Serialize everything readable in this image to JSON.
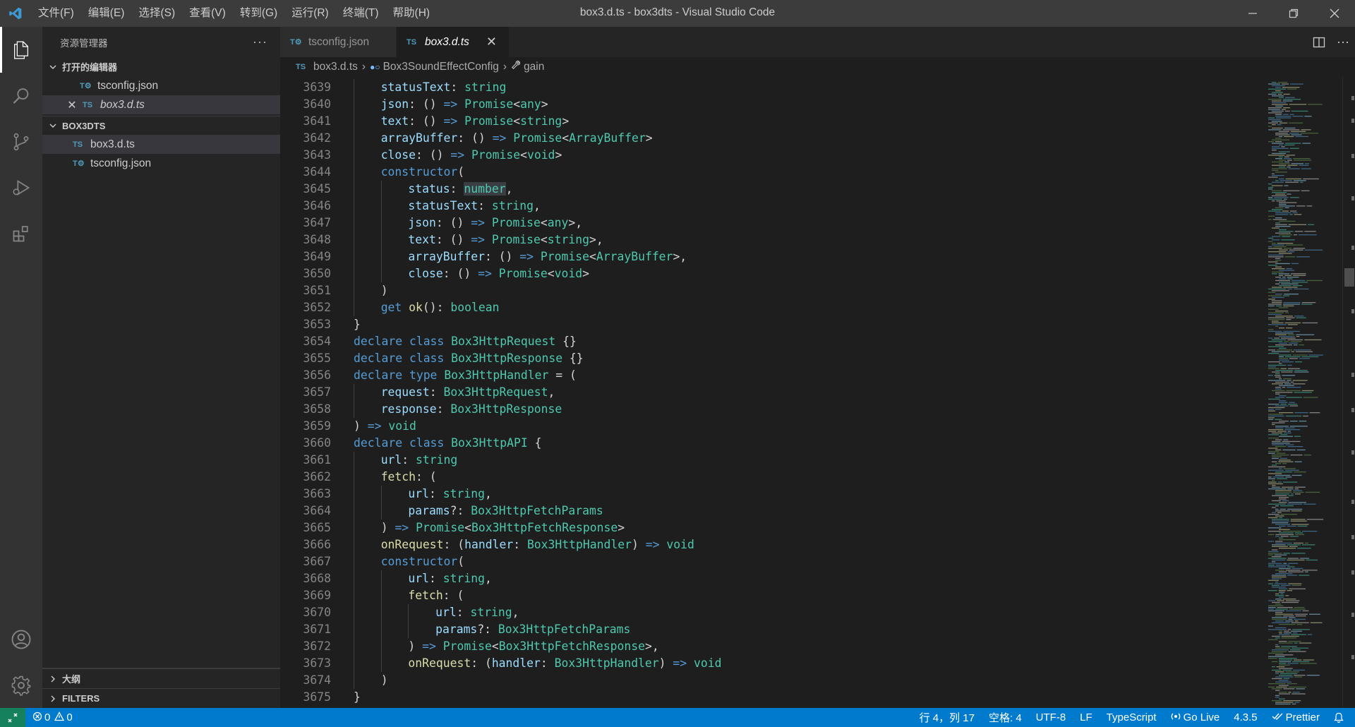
{
  "window": {
    "title": "box3.d.ts - box3dts - Visual Studio Code",
    "menu": [
      "文件(F)",
      "编辑(E)",
      "选择(S)",
      "查看(V)",
      "转到(G)",
      "运行(R)",
      "终端(T)",
      "帮助(H)"
    ]
  },
  "sidebar": {
    "title": "资源管理器",
    "open_editors": {
      "title": "打开的编辑器",
      "items": [
        {
          "icon": "tsconfig-file-icon",
          "label": "tsconfig.json"
        },
        {
          "icon": "typescript-file-icon",
          "label": "box3.d.ts"
        }
      ]
    },
    "folder": {
      "title": "BOX3DTS",
      "items": [
        {
          "icon": "typescript-file-icon",
          "label": "box3.d.ts"
        },
        {
          "icon": "tsconfig-file-icon",
          "label": "tsconfig.json"
        }
      ]
    },
    "outline": "大纲",
    "filters": "FILTERS"
  },
  "tabs": [
    {
      "label": "tsconfig.json",
      "active": false
    },
    {
      "label": "box3.d.ts",
      "active": true
    }
  ],
  "breadcrumb": [
    "box3.d.ts",
    "Box3SoundEffectConfig",
    "gain"
  ],
  "code_lines": [
    {
      "n": "3639",
      "indent": 1
    },
    {
      "n": "3640",
      "indent": 1
    },
    {
      "n": "3641",
      "indent": 1
    },
    {
      "n": "3642",
      "indent": 1
    },
    {
      "n": "3643",
      "indent": 1
    },
    {
      "n": "3644",
      "indent": 1
    },
    {
      "n": "3645",
      "indent": 2
    },
    {
      "n": "3646",
      "indent": 2
    },
    {
      "n": "3647",
      "indent": 2
    },
    {
      "n": "3648",
      "indent": 2
    },
    {
      "n": "3649",
      "indent": 2
    },
    {
      "n": "3650",
      "indent": 2
    },
    {
      "n": "3651",
      "indent": 1
    },
    {
      "n": "3652",
      "indent": 1
    },
    {
      "n": "3653",
      "indent": 0
    },
    {
      "n": "3654",
      "indent": 0
    },
    {
      "n": "3655",
      "indent": 0
    },
    {
      "n": "3656",
      "indent": 0
    },
    {
      "n": "3657",
      "indent": 1
    },
    {
      "n": "3658",
      "indent": 1
    },
    {
      "n": "3659",
      "indent": 0
    },
    {
      "n": "3660",
      "indent": 0
    },
    {
      "n": "3661",
      "indent": 1
    },
    {
      "n": "3662",
      "indent": 1
    },
    {
      "n": "3663",
      "indent": 2
    },
    {
      "n": "3664",
      "indent": 2
    },
    {
      "n": "3665",
      "indent": 1
    },
    {
      "n": "3666",
      "indent": 1
    },
    {
      "n": "3667",
      "indent": 1
    },
    {
      "n": "3668",
      "indent": 2
    },
    {
      "n": "3669",
      "indent": 2
    },
    {
      "n": "3670",
      "indent": 3
    },
    {
      "n": "3671",
      "indent": 3
    },
    {
      "n": "3672",
      "indent": 2
    },
    {
      "n": "3673",
      "indent": 2
    },
    {
      "n": "3674",
      "indent": 1
    },
    {
      "n": "3675",
      "indent": 0
    }
  ],
  "code_tokens": [
    [
      [
        "v",
        "statusText"
      ],
      [
        "p",
        ": "
      ],
      [
        "t",
        "string"
      ]
    ],
    [
      [
        "v",
        "json"
      ],
      [
        "p",
        ": () "
      ],
      [
        "k",
        "=>"
      ],
      [
        "p",
        " "
      ],
      [
        "t",
        "Promise"
      ],
      [
        "p",
        "<"
      ],
      [
        "t",
        "any"
      ],
      [
        "p",
        ">"
      ]
    ],
    [
      [
        "v",
        "text"
      ],
      [
        "p",
        ": () "
      ],
      [
        "k",
        "=>"
      ],
      [
        "p",
        " "
      ],
      [
        "t",
        "Promise"
      ],
      [
        "p",
        "<"
      ],
      [
        "t",
        "string"
      ],
      [
        "p",
        ">"
      ]
    ],
    [
      [
        "v",
        "arrayBuffer"
      ],
      [
        "p",
        ": () "
      ],
      [
        "k",
        "=>"
      ],
      [
        "p",
        " "
      ],
      [
        "t",
        "Promise"
      ],
      [
        "p",
        "<"
      ],
      [
        "t",
        "ArrayBuffer"
      ],
      [
        "p",
        ">"
      ]
    ],
    [
      [
        "v",
        "close"
      ],
      [
        "p",
        ": () "
      ],
      [
        "k",
        "=>"
      ],
      [
        "p",
        " "
      ],
      [
        "t",
        "Promise"
      ],
      [
        "p",
        "<"
      ],
      [
        "t",
        "void"
      ],
      [
        "p",
        ">"
      ]
    ],
    [
      [
        "k",
        "constructor"
      ],
      [
        "p",
        "("
      ]
    ],
    [
      [
        "v",
        "status"
      ],
      [
        "p",
        ": "
      ],
      [
        "t hl",
        "number"
      ],
      [
        "p",
        ","
      ]
    ],
    [
      [
        "v",
        "statusText"
      ],
      [
        "p",
        ": "
      ],
      [
        "t",
        "string"
      ],
      [
        "p",
        ","
      ]
    ],
    [
      [
        "v",
        "json"
      ],
      [
        "p",
        ": () "
      ],
      [
        "k",
        "=>"
      ],
      [
        "p",
        " "
      ],
      [
        "t",
        "Promise"
      ],
      [
        "p",
        "<"
      ],
      [
        "t",
        "any"
      ],
      [
        "p",
        ">,"
      ]
    ],
    [
      [
        "v",
        "text"
      ],
      [
        "p",
        ": () "
      ],
      [
        "k",
        "=>"
      ],
      [
        "p",
        " "
      ],
      [
        "t",
        "Promise"
      ],
      [
        "p",
        "<"
      ],
      [
        "t",
        "string"
      ],
      [
        "p",
        ">,"
      ]
    ],
    [
      [
        "v",
        "arrayBuffer"
      ],
      [
        "p",
        ": () "
      ],
      [
        "k",
        "=>"
      ],
      [
        "p",
        " "
      ],
      [
        "t",
        "Promise"
      ],
      [
        "p",
        "<"
      ],
      [
        "t",
        "ArrayBuffer"
      ],
      [
        "p",
        ">,"
      ]
    ],
    [
      [
        "v",
        "close"
      ],
      [
        "p",
        ": () "
      ],
      [
        "k",
        "=>"
      ],
      [
        "p",
        " "
      ],
      [
        "t",
        "Promise"
      ],
      [
        "p",
        "<"
      ],
      [
        "t",
        "void"
      ],
      [
        "p",
        ">"
      ]
    ],
    [
      [
        "p",
        ")"
      ]
    ],
    [
      [
        "k",
        "get"
      ],
      [
        "p",
        " "
      ],
      [
        "f",
        "ok"
      ],
      [
        "p",
        "(): "
      ],
      [
        "t",
        "boolean"
      ]
    ],
    [
      [
        "p",
        "}"
      ]
    ],
    [
      [
        "k",
        "declare"
      ],
      [
        "p",
        " "
      ],
      [
        "k",
        "class"
      ],
      [
        "p",
        " "
      ],
      [
        "t",
        "Box3HttpRequest"
      ],
      [
        "p",
        " {}"
      ]
    ],
    [
      [
        "k",
        "declare"
      ],
      [
        "p",
        " "
      ],
      [
        "k",
        "class"
      ],
      [
        "p",
        " "
      ],
      [
        "t",
        "Box3HttpResponse"
      ],
      [
        "p",
        " {}"
      ]
    ],
    [
      [
        "k",
        "declare"
      ],
      [
        "p",
        " "
      ],
      [
        "k",
        "type"
      ],
      [
        "p",
        " "
      ],
      [
        "t",
        "Box3HttpHandler"
      ],
      [
        "p",
        " = ("
      ]
    ],
    [
      [
        "v",
        "request"
      ],
      [
        "p",
        ": "
      ],
      [
        "t",
        "Box3HttpRequest"
      ],
      [
        "p",
        ","
      ]
    ],
    [
      [
        "v",
        "response"
      ],
      [
        "p",
        ": "
      ],
      [
        "t",
        "Box3HttpResponse"
      ]
    ],
    [
      [
        "p",
        ") "
      ],
      [
        "k",
        "=>"
      ],
      [
        "p",
        " "
      ],
      [
        "t",
        "void"
      ]
    ],
    [
      [
        "k",
        "declare"
      ],
      [
        "p",
        " "
      ],
      [
        "k",
        "class"
      ],
      [
        "p",
        " "
      ],
      [
        "t",
        "Box3HttpAPI"
      ],
      [
        "p",
        " {"
      ]
    ],
    [
      [
        "v",
        "url"
      ],
      [
        "p",
        ": "
      ],
      [
        "t",
        "string"
      ]
    ],
    [
      [
        "f",
        "fetch"
      ],
      [
        "p",
        ": ("
      ]
    ],
    [
      [
        "v",
        "url"
      ],
      [
        "p",
        ": "
      ],
      [
        "t",
        "string"
      ],
      [
        "p",
        ","
      ]
    ],
    [
      [
        "v",
        "params"
      ],
      [
        "p",
        "?: "
      ],
      [
        "t",
        "Box3HttpFetchParams"
      ]
    ],
    [
      [
        "p",
        ") "
      ],
      [
        "k",
        "=>"
      ],
      [
        "p",
        " "
      ],
      [
        "t",
        "Promise"
      ],
      [
        "p",
        "<"
      ],
      [
        "t",
        "Box3HttpFetchResponse"
      ],
      [
        "p",
        ">"
      ]
    ],
    [
      [
        "f",
        "onRequest"
      ],
      [
        "p",
        ": ("
      ],
      [
        "v",
        "handler"
      ],
      [
        "p",
        ": "
      ],
      [
        "t",
        "Box3HttpHandler"
      ],
      [
        "p",
        ") "
      ],
      [
        "k",
        "=>"
      ],
      [
        "p",
        " "
      ],
      [
        "t",
        "void"
      ]
    ],
    [
      [
        "k",
        "constructor"
      ],
      [
        "p",
        "("
      ]
    ],
    [
      [
        "v",
        "url"
      ],
      [
        "p",
        ": "
      ],
      [
        "t",
        "string"
      ],
      [
        "p",
        ","
      ]
    ],
    [
      [
        "f",
        "fetch"
      ],
      [
        "p",
        ": ("
      ]
    ],
    [
      [
        "v",
        "url"
      ],
      [
        "p",
        ": "
      ],
      [
        "t",
        "string"
      ],
      [
        "p",
        ","
      ]
    ],
    [
      [
        "v",
        "params"
      ],
      [
        "p",
        "?: "
      ],
      [
        "t",
        "Box3HttpFetchParams"
      ]
    ],
    [
      [
        "p",
        ") "
      ],
      [
        "k",
        "=>"
      ],
      [
        "p",
        " "
      ],
      [
        "t",
        "Promise"
      ],
      [
        "p",
        "<"
      ],
      [
        "t",
        "Box3HttpFetchResponse"
      ],
      [
        "p",
        ">,"
      ]
    ],
    [
      [
        "f",
        "onRequest"
      ],
      [
        "p",
        ": ("
      ],
      [
        "v",
        "handler"
      ],
      [
        "p",
        ": "
      ],
      [
        "t",
        "Box3HttpHandler"
      ],
      [
        "p",
        ") "
      ],
      [
        "k",
        "=>"
      ],
      [
        "p",
        " "
      ],
      [
        "t",
        "void"
      ]
    ],
    [
      [
        "p",
        ")"
      ]
    ],
    [
      [
        "p",
        "}"
      ]
    ]
  ],
  "statusbar": {
    "errors": "0",
    "warnings": "0",
    "position": "行 4，列 17",
    "spaces": "空格: 4",
    "encoding": "UTF-8",
    "eol": "LF",
    "language": "TypeScript",
    "golive": "Go Live",
    "version": "4.3.5",
    "prettier": "Prettier"
  },
  "colors": {
    "accent": "#007acc",
    "keyword": "#569cd6",
    "type": "#4ec9b0",
    "variable": "#9cdcfe",
    "function": "#dcdcaa"
  }
}
